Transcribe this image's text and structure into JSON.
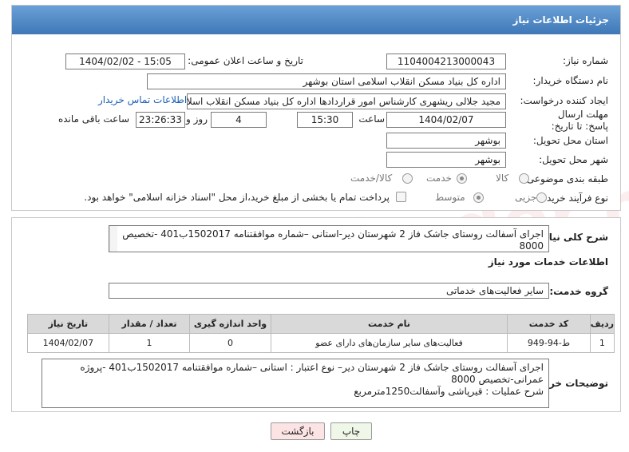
{
  "header": {
    "title": "جزئیات اطلاعات نیاز"
  },
  "form": {
    "need_number_label": "شماره نیاز:",
    "need_number": "1104004213000043",
    "announce_label": "تاریخ و ساعت اعلان عمومی:",
    "announce_value": "1404/02/02 - 15:05",
    "buyer_org_label": "نام دستگاه خریدار:",
    "buyer_org": "اداره کل بنیاد مسکن انقلاب اسلامی استان بوشهر",
    "creator_label": "ایجاد کننده درخواست:",
    "creator": "مجید جلالی ریشهری کارشناس امور قراردادها اداره کل بنیاد مسکن انقلاب اسلا",
    "contact_link": "اطلاعات تماس خریدار",
    "deadline_label": "مهلت ارسال پاسخ: تا تاریخ:",
    "deadline_date": "1404/02/07",
    "time_label": "ساعت",
    "deadline_time": "15:30",
    "days_value": "4",
    "days_label": "روز و",
    "remaining_time": "23:26:33",
    "remaining_label": "ساعت باقی مانده",
    "province_label": "استان محل تحویل:",
    "province": "بوشهر",
    "city_label": "شهر محل تحویل:",
    "city": "بوشهر",
    "category_label": "طبقه بندی موضوعی:",
    "category_options": [
      "کالا",
      "خدمت",
      "کالا/خدمت"
    ],
    "process_label": "نوع فرآیند خرید :",
    "process_options": [
      "جزیی",
      "متوسط"
    ],
    "payment_note": "پرداخت تمام یا بخشی از مبلغ خرید،از محل \"اسناد خزانه اسلامی\" خواهد بود."
  },
  "summary": {
    "label": "شرح کلی نیاز:",
    "text": "اجرای آسفالت روستای جاشک فاز 2  شهرستان دیر-استانی –شماره موافقتنامه 1502017ب401 -تخصیص 8000"
  },
  "services": {
    "section_title": "اطلاعات خدمات مورد نیاز",
    "group_label": "گروه خدمت:",
    "group_value": "سایر فعالیت‌های خدماتی",
    "columns": [
      "ردیف",
      "کد خدمت",
      "نام خدمت",
      "واحد اندازه گیری",
      "تعداد / مقدار",
      "تاریخ نیاز"
    ],
    "rows": [
      {
        "row": "1",
        "code": "ط-94-949",
        "name": "فعالیت‌های سایر سازمان‌های دارای عضو",
        "unit": "0",
        "qty": "1",
        "date": "1404/02/07"
      }
    ]
  },
  "buyer_notes": {
    "label": "توضیحات خریدار:",
    "line1": "اجرای آسفالت روستای جاشک فاز 2  شهرستان دیر– نوع اعتبار : استانی –شماره موافقتنامه 1502017ب401 -پروژه",
    "line2": "عمرانی-تخصیص 8000",
    "line3": "شرح عملیات : قیرپاشی وآسفالت1250مترمربع"
  },
  "buttons": {
    "print": "چاپ",
    "back": "بازگشت"
  },
  "colors": {
    "header_from": "#6aa0d6",
    "header_to": "#3f78b8",
    "back_button": "#fde4e4",
    "print_button": "#eef7e8",
    "link": "#1a5fb4"
  }
}
